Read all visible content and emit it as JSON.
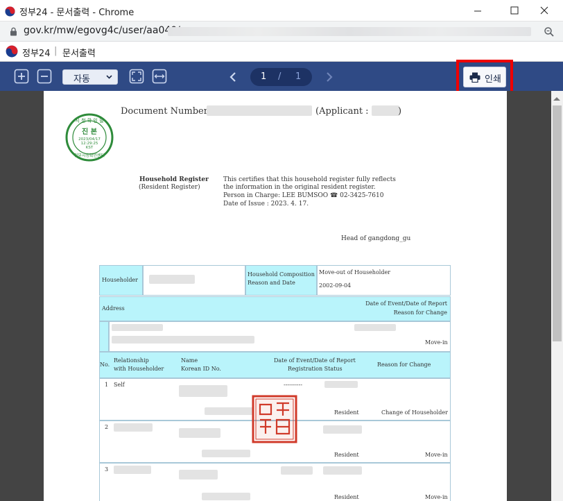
{
  "window": {
    "title": "정부24 - 문서출력 - Chrome",
    "url": "gov.kr/mw/egovg4c/user/aa040/"
  },
  "site": {
    "name": "정부24",
    "separator": "|",
    "page": "문서출력"
  },
  "toolbar": {
    "zoom_value": "자동",
    "current_page": "1",
    "page_separator": "/",
    "total_pages": "1",
    "print_label": "인쇄"
  },
  "document": {
    "doc_number_label": "Document Number:",
    "applicant_label": "(Applicant :",
    "applicant_close": ")",
    "seal": {
      "top_text": "시 청 확 인 필",
      "main": "진 본",
      "date": "2023/04/17",
      "time": "12:29:25",
      "tz": "KST",
      "bottom_text": "정부시청확인센터"
    },
    "title": "Household Register",
    "subtitle": "(Resident Register)",
    "cert_line1": "This certifies that this household register fully reflects",
    "cert_line2": "the information in the original resident register.",
    "person_in_charge": "Person in Charge: LEE BUMSOO ☎ 02-3425-7610",
    "date_of_issue": "Date of Issue   : 2023. 4. 17.",
    "head_of": "Head of gangdong_gu",
    "table": {
      "householder_label": "Householder",
      "composition_label1": "Household Composition",
      "composition_label2": "Reason and Date",
      "moveout_label": "Move-out of Householder",
      "moveout_date": "2002-09-04",
      "address_label": "Address",
      "date_event_label1": "Date of Event/Date of Report",
      "date_event_label2": "Reason for Change",
      "move_in": "Move-in",
      "col_no": "No.",
      "col_rel1": "Relationship",
      "col_rel2": "with Householder",
      "col_name1": "Name",
      "col_name2": "Korean ID No.",
      "col_date1": "Date of Event/Date of Report",
      "col_date2": "Registration Status",
      "col_reason": "Reason for Change",
      "rows": [
        {
          "no": "1",
          "rel": "Self",
          "dash": "----------",
          "status": "Resident",
          "reason": "Change of Householder"
        },
        {
          "no": "2",
          "status": "Resident",
          "reason": "Move-in"
        },
        {
          "no": "3",
          "status": "Resident",
          "reason": "Move-in"
        }
      ]
    }
  }
}
